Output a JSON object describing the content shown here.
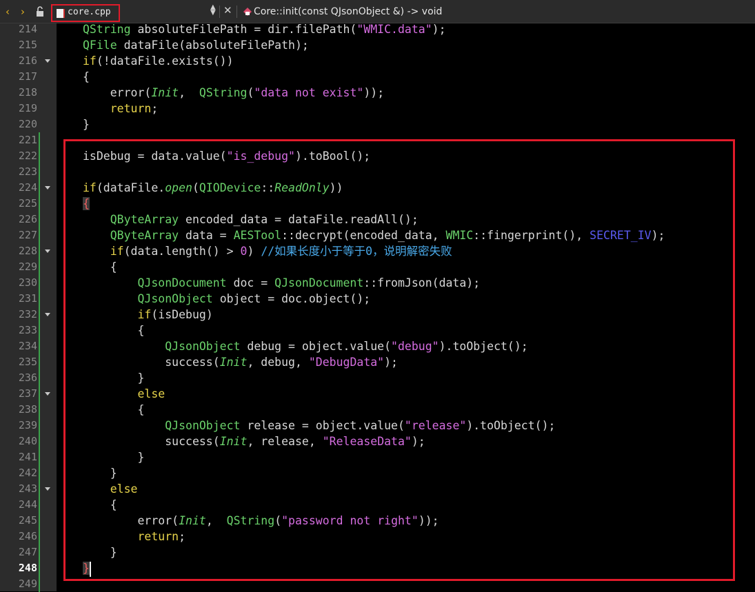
{
  "toolbar": {
    "back_icon": "chevron-left-icon",
    "forward_icon": "chevron-right-icon",
    "lock_icon": "unlock-icon",
    "file_tab_label": "core.cpp",
    "function_label": "Core::init(const QJsonObject &) -> void"
  },
  "colors": {
    "keyword": "#e6d34b",
    "type": "#6bd26b",
    "string": "#d56de0",
    "comment": "#49a8e8",
    "macro": "#5a5af0",
    "highlight_box": "#e01b2a"
  },
  "editor": {
    "current_line": 248,
    "lines": [
      {
        "n": "214",
        "tokens": [
          [
            "ty",
            "QString"
          ],
          [
            "",
            "absoluteFilePath = dir.filePath("
          ],
          [
            "st",
            "\"WMIC.data\""
          ],
          [
            "",
            ");"
          ]
        ]
      },
      {
        "n": "215",
        "tokens": [
          [
            "ty",
            "QFile"
          ],
          [
            "",
            "dataFile(absoluteFilePath);"
          ]
        ]
      },
      {
        "n": "216",
        "tokens": [
          [
            "kw",
            "if"
          ],
          [
            "",
            "(!dataFile.exists())"
          ]
        ]
      },
      {
        "n": "217",
        "tokens": [
          [
            "",
            "{"
          ]
        ]
      },
      {
        "n": "218",
        "tokens": [
          [
            "",
            "    error("
          ],
          [
            "it",
            "Init"
          ],
          [
            "",
            ",  "
          ],
          [
            "ty",
            "QString"
          ],
          [
            "",
            "("
          ],
          [
            "st",
            "\"data not exist\""
          ],
          [
            "",
            "));"
          ]
        ]
      },
      {
        "n": "219",
        "tokens": [
          [
            "kw",
            "    return"
          ],
          [
            "",
            ";"
          ]
        ]
      },
      {
        "n": "220",
        "tokens": [
          [
            "",
            "}"
          ]
        ]
      },
      {
        "n": "221",
        "tokens": []
      },
      {
        "n": "222",
        "tokens": [
          [
            "",
            "isDebug = data.value("
          ],
          [
            "st",
            "\"is_debug\""
          ],
          [
            "",
            ").toBool();"
          ]
        ]
      },
      {
        "n": "223",
        "tokens": []
      },
      {
        "n": "224",
        "tokens": [
          [
            "kw",
            "if"
          ],
          [
            "",
            "(dataFile."
          ],
          [
            "it",
            "open"
          ],
          [
            "",
            "("
          ],
          [
            "ty",
            "QIODevice"
          ],
          [
            "",
            "::"
          ],
          [
            "it",
            "ReadOnly"
          ],
          [
            "",
            "))"
          ]
        ]
      },
      {
        "n": "225",
        "tokens": [
          [
            "hb",
            "{"
          ]
        ]
      },
      {
        "n": "226",
        "tokens": [
          [
            "ty",
            "    QByteArray"
          ],
          [
            "",
            "encoded_data = dataFile.readAll();"
          ]
        ]
      },
      {
        "n": "227",
        "tokens": [
          [
            "ty",
            "    QByteArray"
          ],
          [
            "",
            "data = "
          ],
          [
            "ty",
            "AESTool"
          ],
          [
            "",
            "::decrypt(encoded_data, "
          ],
          [
            "ty",
            "WMIC"
          ],
          [
            "",
            "::fingerprint(), "
          ],
          [
            "mc",
            "SECRET_IV"
          ],
          [
            "",
            ");"
          ]
        ]
      },
      {
        "n": "228",
        "tokens": [
          [
            "kw",
            "    if"
          ],
          [
            "",
            "(data.length() > "
          ],
          [
            "num",
            "0"
          ],
          [
            "",
            ") "
          ],
          [
            "cm",
            "//如果长度小于等于0，说明解密失败"
          ]
        ]
      },
      {
        "n": "229",
        "tokens": [
          [
            "",
            "    {"
          ]
        ]
      },
      {
        "n": "230",
        "tokens": [
          [
            "ty",
            "        QJsonDocument"
          ],
          [
            "",
            "doc = "
          ],
          [
            "ty",
            "QJsonDocument"
          ],
          [
            "",
            "::fromJson(data);"
          ]
        ]
      },
      {
        "n": "231",
        "tokens": [
          [
            "ty",
            "        QJsonObject"
          ],
          [
            "",
            "object = doc.object();"
          ]
        ]
      },
      {
        "n": "232",
        "tokens": [
          [
            "kw",
            "        if"
          ],
          [
            "",
            "(isDebug)"
          ]
        ]
      },
      {
        "n": "233",
        "tokens": [
          [
            "",
            "        {"
          ]
        ]
      },
      {
        "n": "234",
        "tokens": [
          [
            "ty",
            "            QJsonObject"
          ],
          [
            "",
            "debug = object.value("
          ],
          [
            "st",
            "\"debug\""
          ],
          [
            "",
            ").toObject();"
          ]
        ]
      },
      {
        "n": "235",
        "tokens": [
          [
            "",
            "            success("
          ],
          [
            "it",
            "Init"
          ],
          [
            "",
            ", debug, "
          ],
          [
            "st",
            "\"DebugData\""
          ],
          [
            "",
            ");"
          ]
        ]
      },
      {
        "n": "236",
        "tokens": [
          [
            "",
            "        }"
          ]
        ]
      },
      {
        "n": "237",
        "tokens": [
          [
            "kw",
            "        else"
          ]
        ]
      },
      {
        "n": "238",
        "tokens": [
          [
            "",
            "        {"
          ]
        ]
      },
      {
        "n": "239",
        "tokens": [
          [
            "ty",
            "            QJsonObject"
          ],
          [
            "",
            "release = object.value("
          ],
          [
            "st",
            "\"release\""
          ],
          [
            "",
            ").toObject();"
          ]
        ]
      },
      {
        "n": "240",
        "tokens": [
          [
            "",
            "            success("
          ],
          [
            "it",
            "Init"
          ],
          [
            "",
            ", release, "
          ],
          [
            "st",
            "\"ReleaseData\""
          ],
          [
            "",
            ");"
          ]
        ]
      },
      {
        "n": "241",
        "tokens": [
          [
            "",
            "        }"
          ]
        ]
      },
      {
        "n": "242",
        "tokens": [
          [
            "",
            "    }"
          ]
        ]
      },
      {
        "n": "243",
        "tokens": [
          [
            "kw",
            "    else"
          ]
        ]
      },
      {
        "n": "244",
        "tokens": [
          [
            "",
            "    {"
          ]
        ]
      },
      {
        "n": "245",
        "tokens": [
          [
            "",
            "        error("
          ],
          [
            "it",
            "Init"
          ],
          [
            "",
            ",  "
          ],
          [
            "ty",
            "QString"
          ],
          [
            "",
            "("
          ],
          [
            "st",
            "\"password not right\""
          ],
          [
            "",
            "));"
          ]
        ]
      },
      {
        "n": "246",
        "tokens": [
          [
            "kw",
            "        return"
          ],
          [
            "",
            ";"
          ]
        ]
      },
      {
        "n": "247",
        "tokens": [
          [
            "",
            "    }"
          ]
        ]
      },
      {
        "n": "248",
        "tokens": [
          [
            "hb",
            "}"
          ]
        ]
      },
      {
        "n": "249",
        "tokens": []
      }
    ]
  }
}
